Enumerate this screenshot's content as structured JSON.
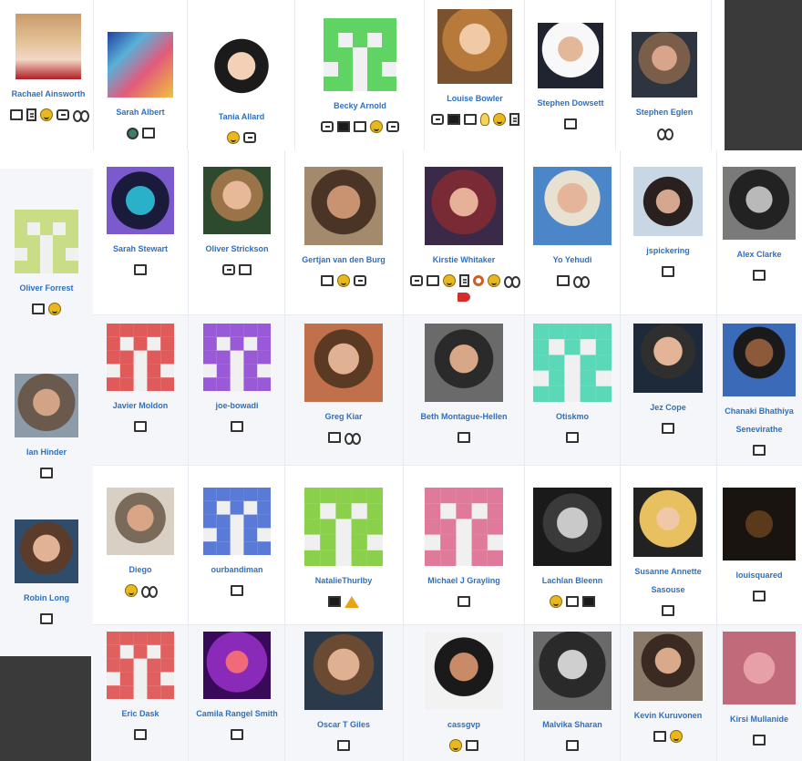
{
  "page": {
    "background": "#ffffff",
    "accent": "#2f6fc0",
    "overlay": "#3a3a3a"
  },
  "top_strip": [
    {
      "name": "Rachael Ainsworth",
      "avatar": "rachael-ainsworth-photo",
      "badges": [
        "laptop-icon",
        "doc-icon",
        "smile-icon",
        "chat-icon",
        "eyes-icon"
      ]
    },
    {
      "name": "Sarah Albert",
      "avatar": "sarah-albert-pixel-art",
      "badges": [
        "globe-icon",
        "laptop-icon"
      ]
    },
    {
      "name": "Tania Allard",
      "avatar": "tania-allard-cartoon",
      "badges": [
        "smile-icon",
        "chat-icon"
      ]
    },
    {
      "name": "Becky Arnold",
      "avatar": "becky-arnold-identicon",
      "badges": [
        "chat-icon",
        "desktop-icon",
        "laptop-icon",
        "smile-icon",
        "chat-icon"
      ]
    },
    {
      "name": "Louise Bowler",
      "avatar": "louise-bowler-photo",
      "badges": [
        "chat-icon",
        "desktop-icon",
        "laptop-icon",
        "bulb-icon",
        "smile-icon",
        "doc-icon"
      ]
    },
    {
      "name": "Stephen Dowsett",
      "avatar": "stephen-dowsett-photo",
      "badges": [
        "laptop-icon"
      ]
    },
    {
      "name": "Stephen Eglen",
      "avatar": "stephen-eglen-photo",
      "badges": [
        "eyes-icon"
      ]
    }
  ],
  "left_column": [
    {
      "name": "Oliver Forrest",
      "avatar": "oliver-forrest-identicon",
      "badges": [
        "laptop-icon",
        "smile-icon"
      ]
    },
    {
      "name": "Ian Hinder",
      "avatar": "ian-hinder-photo",
      "badges": [
        "laptop-icon"
      ]
    },
    {
      "name": "Robin Long",
      "avatar": "robin-long-photo",
      "badges": [
        "laptop-icon"
      ]
    }
  ],
  "grid_rows": [
    [
      {
        "name": "Sarah Stewart",
        "avatar": "sarah-stewart-photo",
        "badges": [
          "laptop-icon"
        ]
      },
      {
        "name": "Oliver Strickson",
        "avatar": "oliver-strickson-photo",
        "badges": [
          "chat-icon",
          "laptop-icon"
        ]
      },
      {
        "name": "Gertjan van den Burg",
        "avatar": "gertjan-photo",
        "badges": [
          "laptop-icon",
          "smile-icon",
          "chat-icon"
        ]
      },
      {
        "name": "Kirstie Whitaker",
        "avatar": "kirstie-whitaker-photo",
        "badges": [
          "chat-icon",
          "laptop-icon",
          "smile-icon",
          "doc-icon",
          "search-icon",
          "smile-icon",
          "eyes-icon",
          "megaphone-icon"
        ]
      },
      {
        "name": "Yo Yehudi",
        "avatar": "yo-yehudi-photo",
        "badges": [
          "laptop-icon",
          "eyes-icon"
        ]
      },
      {
        "name": "jspickering",
        "avatar": "jspickering-photo",
        "badges": [
          "laptop-icon"
        ]
      },
      {
        "name": "Alex Clarke",
        "avatar": "alex-clarke-photo",
        "badges": [
          "laptop-icon"
        ]
      }
    ],
    [
      {
        "name": "Javier Moldon",
        "avatar": "javier-moldon-identicon",
        "badges": [
          "laptop-icon"
        ]
      },
      {
        "name": "joe-bowadi",
        "avatar": "joe-bowadi-identicon",
        "badges": [
          "laptop-icon"
        ]
      },
      {
        "name": "Greg Kiar",
        "avatar": "greg-kiar-photo",
        "badges": [
          "laptop-icon",
          "eyes-icon"
        ]
      },
      {
        "name": "Beth Montague-Hellen",
        "avatar": "beth-montague-hellen-photo",
        "badges": [
          "laptop-icon"
        ]
      },
      {
        "name": "Otiskmo",
        "avatar": "otiskmo-identicon",
        "badges": [
          "laptop-icon"
        ]
      },
      {
        "name": "Jez Cope",
        "avatar": "jez-cope-photo",
        "badges": [
          "laptop-icon"
        ]
      },
      {
        "name": "Chanaki Bhathiya Senevirathe",
        "avatar": "chanaki-photo",
        "badges": [
          "laptop-icon"
        ]
      }
    ],
    [
      {
        "name": "Diego",
        "avatar": "diego-photo",
        "badges": [
          "smile-icon",
          "eyes-icon"
        ]
      },
      {
        "name": "ourbandiman",
        "avatar": "ourbandiman-identicon",
        "badges": [
          "laptop-icon"
        ]
      },
      {
        "name": "NatalieThurlby",
        "avatar": "natalie-thurlby-identicon",
        "badges": [
          "desktop-icon",
          "warning-icon"
        ]
      },
      {
        "name": "Michael J Grayling",
        "avatar": "michael-grayling-identicon",
        "badges": [
          "laptop-icon"
        ]
      },
      {
        "name": "Lachlan Bleenn",
        "avatar": "lachlan-photo",
        "badges": [
          "smile-icon",
          "laptop-icon",
          "desktop-icon"
        ]
      },
      {
        "name": "Susanne Annette Sasouse",
        "avatar": "susanne-photo",
        "badges": [
          "laptop-icon"
        ]
      },
      {
        "name": "louisquared",
        "avatar": "louisquared-photo",
        "badges": [
          "laptop-icon"
        ]
      }
    ],
    [
      {
        "name": "Eric Dask",
        "avatar": "eric-dask-identicon",
        "badges": [
          "laptop-icon"
        ]
      },
      {
        "name": "Camila Rangel Smith",
        "avatar": "camila-rangel-smith-art",
        "badges": [
          "laptop-icon"
        ]
      },
      {
        "name": "Oscar T Giles",
        "avatar": "oscar-giles-photo",
        "badges": [
          "laptop-icon"
        ]
      },
      {
        "name": "cassgvp",
        "avatar": "cassgvp-photo",
        "badges": [
          "smile-icon",
          "laptop-icon"
        ]
      },
      {
        "name": "Malvika Sharan",
        "avatar": "malvika-sharan-photo",
        "badges": [
          "laptop-icon"
        ]
      },
      {
        "name": "Kevin Kuruvonen",
        "avatar": "kevin-photo",
        "badges": [
          "laptop-icon",
          "smile-icon"
        ]
      },
      {
        "name": "Kirsi Mullanide",
        "avatar": "kirsi-photo",
        "badges": [
          "laptop-icon"
        ]
      }
    ]
  ]
}
